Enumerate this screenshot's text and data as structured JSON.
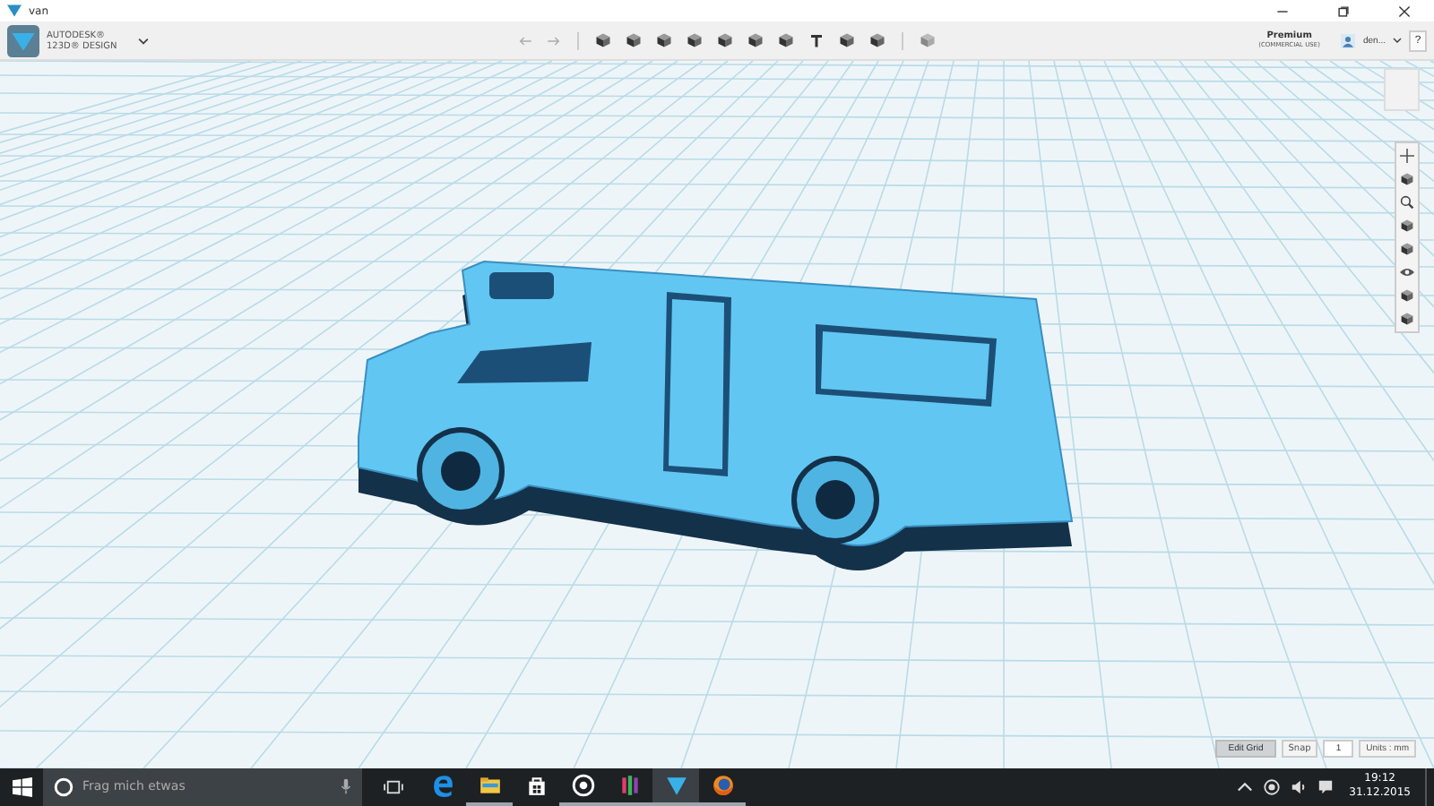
{
  "window": {
    "title": "van"
  },
  "app_bar": {
    "brand_line1": "AUTODESK®",
    "brand_line2": "123D® DESIGN",
    "plan": "Premium",
    "plan_note": "(COMMERCIAL USE)",
    "user": "den...",
    "help": "?"
  },
  "grid_controls": {
    "edit_grid": "Edit Grid",
    "snap_label": "Snap",
    "snap_value": "1",
    "units_label": "Units : mm"
  },
  "taskbar": {
    "search": {
      "placeholder": "Frag mich etwas"
    },
    "apps": [
      {
        "kind": "edge",
        "running": false,
        "selected": false
      },
      {
        "kind": "explorer",
        "running": true,
        "selected": false
      },
      {
        "kind": "store",
        "running": false,
        "selected": false
      },
      {
        "kind": "groove",
        "running": true,
        "selected": false
      },
      {
        "kind": "bars",
        "running": true,
        "selected": false
      },
      {
        "kind": "design",
        "running": true,
        "selected": true
      },
      {
        "kind": "firefox",
        "running": true,
        "selected": false
      }
    ],
    "time": "19:12",
    "date": "31.12.2015"
  }
}
